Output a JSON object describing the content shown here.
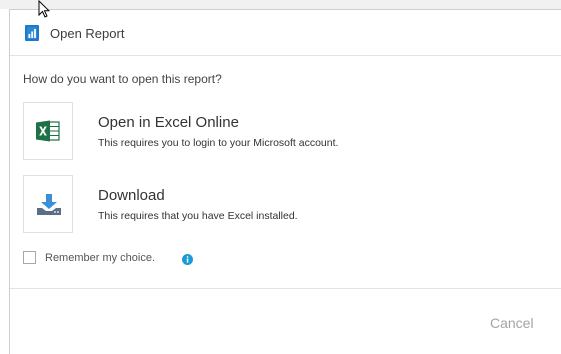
{
  "dialog": {
    "title": "Open Report",
    "app_icon": "report-chart-icon",
    "question": "How do you want to open this report?"
  },
  "options": [
    {
      "title": "Open in Excel Online",
      "description": "This requires you to login to your Microsoft account.",
      "icon": "excel-icon"
    },
    {
      "title": "Download",
      "description": "This requires that you have Excel installed.",
      "icon": "download-icon"
    }
  ],
  "remember": {
    "label": "Remember my choice.",
    "checked": false,
    "icon": "info-icon"
  },
  "footer": {
    "cancel_label": "Cancel"
  },
  "colors": {
    "accent_blue": "#1f78c8",
    "excel_green": "#1e7145",
    "info_blue": "#1a9ad6",
    "download_blue": "#3a8fd6",
    "download_tray": "#5a6f86",
    "cancel_gray": "#a4a4a4"
  }
}
